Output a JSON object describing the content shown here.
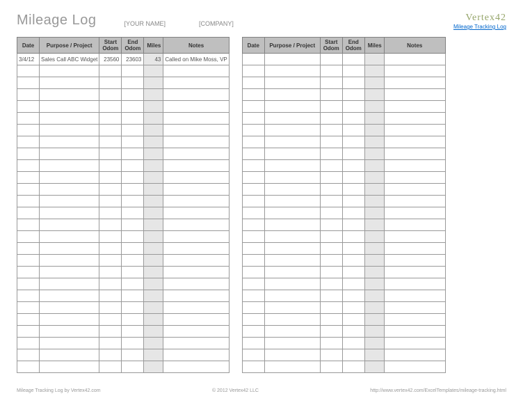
{
  "header": {
    "title": "Mileage Log",
    "name_field": "[YOUR NAME]",
    "company_field": "[COMPANY]",
    "brand": "Vertex42",
    "brand_link": "Mileage Tracking Log"
  },
  "columns": {
    "date": "Date",
    "purpose": "Purpose / Project",
    "start": "Start Odom",
    "end": "End Odom",
    "miles": "Miles",
    "notes": "Notes"
  },
  "left_rows": [
    {
      "date": "3/4/12",
      "purpose": "Sales Call ABC Widget",
      "start": "23560",
      "end": "23603",
      "miles": "43",
      "notes": "Called on Mike Moss, VP"
    },
    {
      "date": "",
      "purpose": "",
      "start": "",
      "end": "",
      "miles": "",
      "notes": ""
    },
    {
      "date": "",
      "purpose": "",
      "start": "",
      "end": "",
      "miles": "",
      "notes": ""
    },
    {
      "date": "",
      "purpose": "",
      "start": "",
      "end": "",
      "miles": "",
      "notes": ""
    },
    {
      "date": "",
      "purpose": "",
      "start": "",
      "end": "",
      "miles": "",
      "notes": ""
    },
    {
      "date": "",
      "purpose": "",
      "start": "",
      "end": "",
      "miles": "",
      "notes": ""
    },
    {
      "date": "",
      "purpose": "",
      "start": "",
      "end": "",
      "miles": "",
      "notes": ""
    },
    {
      "date": "",
      "purpose": "",
      "start": "",
      "end": "",
      "miles": "",
      "notes": ""
    },
    {
      "date": "",
      "purpose": "",
      "start": "",
      "end": "",
      "miles": "",
      "notes": ""
    },
    {
      "date": "",
      "purpose": "",
      "start": "",
      "end": "",
      "miles": "",
      "notes": ""
    },
    {
      "date": "",
      "purpose": "",
      "start": "",
      "end": "",
      "miles": "",
      "notes": ""
    },
    {
      "date": "",
      "purpose": "",
      "start": "",
      "end": "",
      "miles": "",
      "notes": ""
    },
    {
      "date": "",
      "purpose": "",
      "start": "",
      "end": "",
      "miles": "",
      "notes": ""
    },
    {
      "date": "",
      "purpose": "",
      "start": "",
      "end": "",
      "miles": "",
      "notes": ""
    },
    {
      "date": "",
      "purpose": "",
      "start": "",
      "end": "",
      "miles": "",
      "notes": ""
    },
    {
      "date": "",
      "purpose": "",
      "start": "",
      "end": "",
      "miles": "",
      "notes": ""
    },
    {
      "date": "",
      "purpose": "",
      "start": "",
      "end": "",
      "miles": "",
      "notes": ""
    },
    {
      "date": "",
      "purpose": "",
      "start": "",
      "end": "",
      "miles": "",
      "notes": ""
    },
    {
      "date": "",
      "purpose": "",
      "start": "",
      "end": "",
      "miles": "",
      "notes": ""
    },
    {
      "date": "",
      "purpose": "",
      "start": "",
      "end": "",
      "miles": "",
      "notes": ""
    },
    {
      "date": "",
      "purpose": "",
      "start": "",
      "end": "",
      "miles": "",
      "notes": ""
    },
    {
      "date": "",
      "purpose": "",
      "start": "",
      "end": "",
      "miles": "",
      "notes": ""
    },
    {
      "date": "",
      "purpose": "",
      "start": "",
      "end": "",
      "miles": "",
      "notes": ""
    },
    {
      "date": "",
      "purpose": "",
      "start": "",
      "end": "",
      "miles": "",
      "notes": ""
    },
    {
      "date": "",
      "purpose": "",
      "start": "",
      "end": "",
      "miles": "",
      "notes": ""
    },
    {
      "date": "",
      "purpose": "",
      "start": "",
      "end": "",
      "miles": "",
      "notes": ""
    },
    {
      "date": "",
      "purpose": "",
      "start": "",
      "end": "",
      "miles": "",
      "notes": ""
    }
  ],
  "right_row_count": 27,
  "footer": {
    "left": "Mileage Tracking Log by Vertex42.com",
    "center": "© 2012 Vertex42 LLC",
    "right": "http://www.vertex42.com/ExcelTemplates/mileage-tracking.html"
  }
}
